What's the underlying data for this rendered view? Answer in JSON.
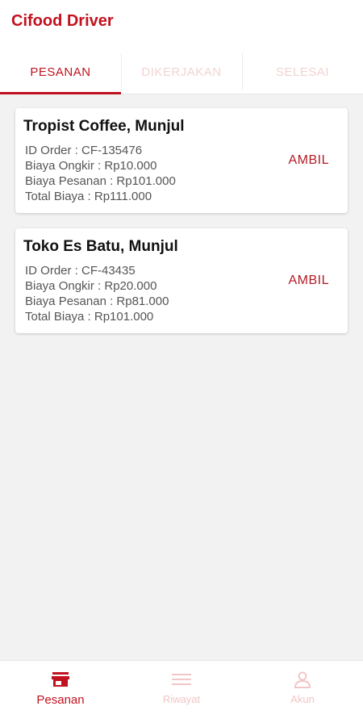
{
  "app": {
    "title": "Cifood Driver"
  },
  "tabs": [
    {
      "label": "PESANAN",
      "active": true
    },
    {
      "label": "DIKERJAKAN",
      "active": false
    },
    {
      "label": "SELESAI",
      "active": false
    }
  ],
  "orders": [
    {
      "name": "Tropist Coffee, Munjul",
      "id_line": "ID Order : CF-135476",
      "ongkir_line": "Biaya Ongkir : Rp10.000",
      "pesanan_line": "Biaya Pesanan : Rp101.000",
      "total_line": "Total Biaya : Rp111.000",
      "action": "AMBIL"
    },
    {
      "name": "Toko Es Batu, Munjul",
      "id_line": "ID Order : CF-43435",
      "ongkir_line": "Biaya Ongkir : Rp20.000",
      "pesanan_line": "Biaya Pesanan : Rp81.000",
      "total_line": "Total Biaya : Rp101.000",
      "action": "AMBIL"
    }
  ],
  "bottom_nav": [
    {
      "label": "Pesanan",
      "icon": "store-icon",
      "active": true
    },
    {
      "label": "Riwayat",
      "icon": "menu-icon",
      "active": false
    },
    {
      "label": "Akun",
      "icon": "person-icon",
      "active": false
    }
  ],
  "colors": {
    "accent": "#c1121f",
    "background": "#f2f2f2",
    "inactive_tab": "#f3d3d3"
  }
}
